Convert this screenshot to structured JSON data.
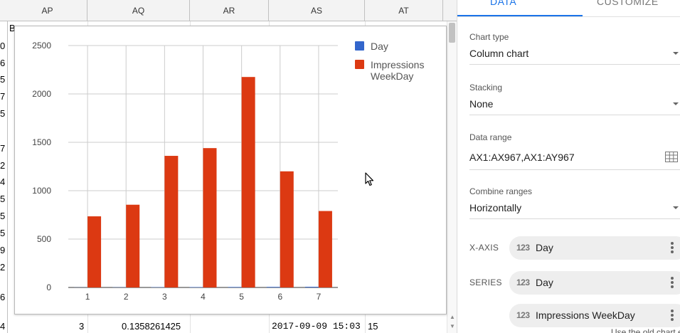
{
  "sheet": {
    "columns": [
      "AP",
      "AQ",
      "AR",
      "AS",
      "AT"
    ],
    "row_fragments": [
      "B",
      "0",
      "6",
      "5",
      "7",
      "5",
      "7",
      "2",
      "4",
      "5",
      "5",
      "5",
      "9",
      "2",
      "6",
      "4"
    ],
    "last_row": {
      "ap": "3",
      "aq": "0.1358261425",
      "as": "2017-09-09 15:03",
      "at": "15"
    }
  },
  "chart_data": {
    "type": "bar",
    "categories": [
      "1",
      "2",
      "3",
      "4",
      "5",
      "6",
      "7"
    ],
    "series": [
      {
        "name": "Day",
        "values": [
          1,
          2,
          3,
          4,
          5,
          6,
          7
        ],
        "color": "#3366cc"
      },
      {
        "name": "Impressions WeekDay",
        "values": [
          735,
          855,
          1360,
          1440,
          2175,
          1200,
          790
        ],
        "color": "#dc3912"
      }
    ],
    "legend": "right",
    "ylim": [
      0,
      2500
    ],
    "yticks": [
      "0",
      "500",
      "1000",
      "1500",
      "2000",
      "2500"
    ],
    "grid": true,
    "title": "",
    "xlabel": "",
    "ylabel": ""
  },
  "legend_lines": {
    "day": [
      "Day"
    ],
    "impressions": [
      "Impressions",
      "WeekDay"
    ]
  },
  "editor": {
    "tabs": {
      "data": "DATA",
      "customize": "CUSTOMIZE"
    },
    "chart_type": {
      "label": "Chart type",
      "value": "Column chart"
    },
    "stacking": {
      "label": "Stacking",
      "value": "None"
    },
    "data_range": {
      "label": "Data range",
      "value": "AX1:AX967,AX1:AY967"
    },
    "combine_ranges": {
      "label": "Combine ranges",
      "value": "Horizontally"
    },
    "x_axis": {
      "label": "X-AXIS",
      "chip": "Day"
    },
    "series": {
      "label": "SERIES",
      "chips": [
        "Day",
        "Impressions WeekDay"
      ]
    },
    "chip_icon": "123",
    "old_chart_link": "Use the old chart e"
  },
  "icons": {
    "dropdown": "triangle-down-icon",
    "range": "grid-icon",
    "chip": "number-type-icon",
    "menu": "kebab-icon",
    "cursor": "mouse-pointer-icon"
  }
}
